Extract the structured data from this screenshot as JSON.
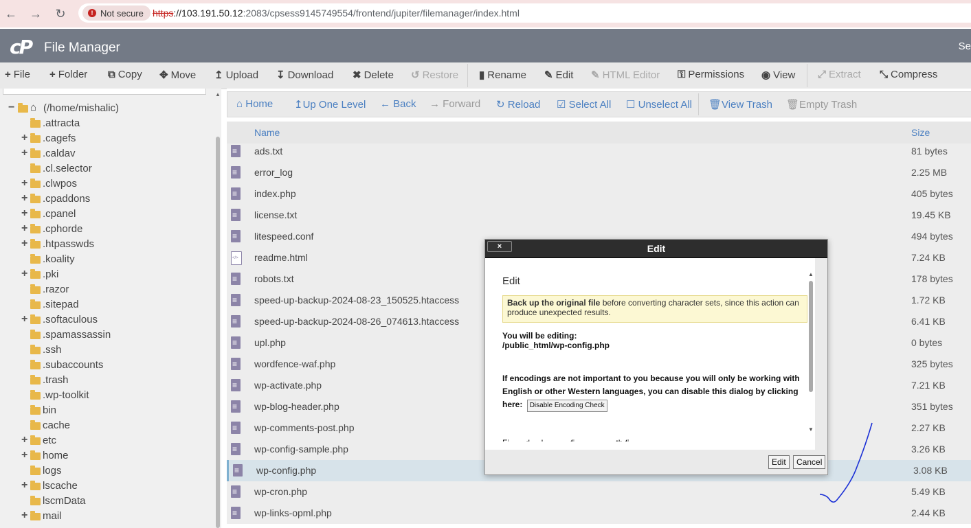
{
  "browser": {
    "security_label": "Not secure",
    "url_scheme": "https",
    "url_host": "://103.191.50.12",
    "url_path": ":2083/cpsess9145749554/frontend/jupiter/filemanager/index.html"
  },
  "header": {
    "logo": "cP",
    "title": "File Manager",
    "right_text": "Se"
  },
  "toolbar": {
    "file": "File",
    "folder": "Folder",
    "copy": "Copy",
    "move": "Move",
    "upload": "Upload",
    "download": "Download",
    "delete": "Delete",
    "restore": "Restore",
    "rename": "Rename",
    "edit": "Edit",
    "html_editor": "HTML Editor",
    "permissions": "Permissions",
    "view": "View",
    "extract": "Extract",
    "compress": "Compress"
  },
  "tree": {
    "root": "(/home/mishalic)",
    "items": [
      {
        "label": ".attracta",
        "expandable": false
      },
      {
        "label": ".cagefs",
        "expandable": true
      },
      {
        "label": ".caldav",
        "expandable": true
      },
      {
        "label": ".cl.selector",
        "expandable": false
      },
      {
        "label": ".clwpos",
        "expandable": true
      },
      {
        "label": ".cpaddons",
        "expandable": true
      },
      {
        "label": ".cpanel",
        "expandable": true
      },
      {
        "label": ".cphorde",
        "expandable": true
      },
      {
        "label": ".htpasswds",
        "expandable": true
      },
      {
        "label": ".koality",
        "expandable": false
      },
      {
        "label": ".pki",
        "expandable": true
      },
      {
        "label": ".razor",
        "expandable": false
      },
      {
        "label": ".sitepad",
        "expandable": false
      },
      {
        "label": ".softaculous",
        "expandable": true
      },
      {
        "label": ".spamassassin",
        "expandable": false
      },
      {
        "label": ".ssh",
        "expandable": false
      },
      {
        "label": ".subaccounts",
        "expandable": false
      },
      {
        "label": ".trash",
        "expandable": false
      },
      {
        "label": ".wp-toolkit",
        "expandable": false
      },
      {
        "label": "bin",
        "expandable": false
      },
      {
        "label": "cache",
        "expandable": false
      },
      {
        "label": "etc",
        "expandable": true
      },
      {
        "label": "home",
        "expandable": true
      },
      {
        "label": "logs",
        "expandable": false
      },
      {
        "label": "lscache",
        "expandable": true
      },
      {
        "label": "lscmData",
        "expandable": false
      },
      {
        "label": "mail",
        "expandable": true
      }
    ]
  },
  "navbar": {
    "home": "Home",
    "up_one_level": "Up One Level",
    "back": "Back",
    "forward": "Forward",
    "reload": "Reload",
    "select_all": "Select All",
    "unselect_all": "Unselect All",
    "view_trash": "View Trash",
    "empty_trash": "Empty Trash"
  },
  "table": {
    "col_name": "Name",
    "col_size": "Size",
    "rows": [
      {
        "name": "ads.txt",
        "size": "81 bytes",
        "icon": "text-file-icon"
      },
      {
        "name": "error_log",
        "size": "2.25 MB",
        "icon": "text-file-icon"
      },
      {
        "name": "index.php",
        "size": "405 bytes",
        "icon": "text-file-icon"
      },
      {
        "name": "license.txt",
        "size": "19.45 KB",
        "icon": "text-file-icon"
      },
      {
        "name": "litespeed.conf",
        "size": "494 bytes",
        "icon": "text-file-icon"
      },
      {
        "name": "readme.html",
        "size": "7.24 KB",
        "icon": "html-file-icon"
      },
      {
        "name": "robots.txt",
        "size": "178 bytes",
        "icon": "text-file-icon"
      },
      {
        "name": "speed-up-backup-2024-08-23_150525.htaccess",
        "size": "1.72 KB",
        "icon": "text-file-icon"
      },
      {
        "name": "speed-up-backup-2024-08-26_074613.htaccess",
        "size": "6.41 KB",
        "icon": "text-file-icon"
      },
      {
        "name": "upl.php",
        "size": "0 bytes",
        "icon": "text-file-icon"
      },
      {
        "name": "wordfence-waf.php",
        "size": "325 bytes",
        "icon": "text-file-icon"
      },
      {
        "name": "wp-activate.php",
        "size": "7.21 KB",
        "icon": "text-file-icon"
      },
      {
        "name": "wp-blog-header.php",
        "size": "351 bytes",
        "icon": "text-file-icon"
      },
      {
        "name": "wp-comments-post.php",
        "size": "2.27 KB",
        "icon": "text-file-icon"
      },
      {
        "name": "wp-config-sample.php",
        "size": "3.26 KB",
        "icon": "text-file-icon"
      },
      {
        "name": "wp-config.php",
        "size": "3.08 KB",
        "icon": "text-file-icon",
        "selected": true
      },
      {
        "name": "wp-cron.php",
        "size": "5.49 KB",
        "icon": "text-file-icon"
      },
      {
        "name": "wp-links-opml.php",
        "size": "2.44 KB",
        "icon": "text-file-icon"
      }
    ]
  },
  "modal": {
    "title": "Edit",
    "close": "×",
    "heading": "Edit",
    "warn_bold": "Back up the original file",
    "warn_rest": " before converting character sets, since this action can produce unexpected results.",
    "editing_label": "You will be editing:",
    "editing_path": "/public_html/wp-config.php",
    "encoding_text": "If encodings are not important to you because you will only be working with English or other Western languages, you can disable this dialog by clicking here:",
    "disable_button": "Disable Encoding Check",
    "cut_text": "Fi...  ...d ... l...  ...  ... fi...  ...  ... . ... th fi",
    "edit_button": "Edit",
    "cancel_button": "Cancel"
  },
  "colors": {
    "header_bg": "#737a86",
    "link_blue": "#4a7fc1",
    "modal_head": "#2d2d2d",
    "warn_bg": "#fcf8d3",
    "scribble": "#1a2fd6"
  }
}
